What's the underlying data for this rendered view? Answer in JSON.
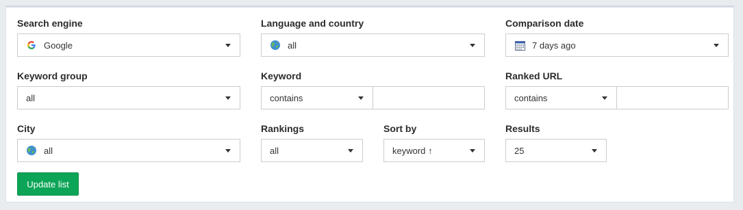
{
  "filters": {
    "search_engine": {
      "label": "Search engine",
      "value": "Google",
      "icon": "google-icon"
    },
    "language_country": {
      "label": "Language and country",
      "value": "all",
      "icon": "globe-icon"
    },
    "comparison_date": {
      "label": "Comparison date",
      "value": "7 days ago",
      "icon": "calendar-icon"
    },
    "keyword_group": {
      "label": "Keyword group",
      "value": "all"
    },
    "keyword": {
      "label": "Keyword",
      "match": "contains",
      "value": ""
    },
    "ranked_url": {
      "label": "Ranked URL",
      "match": "contains",
      "value": ""
    },
    "city": {
      "label": "City",
      "value": "all",
      "icon": "globe-icon"
    },
    "rankings": {
      "label": "Rankings",
      "value": "all"
    },
    "sort_by": {
      "label": "Sort by",
      "value": "keyword ↑"
    },
    "results": {
      "label": "Results",
      "value": "25"
    }
  },
  "actions": {
    "update_label": "Update list"
  },
  "colors": {
    "primary_button": "#0ca557",
    "border": "#cccccc",
    "background": "#e9ecef",
    "panel": "#ffffff"
  }
}
